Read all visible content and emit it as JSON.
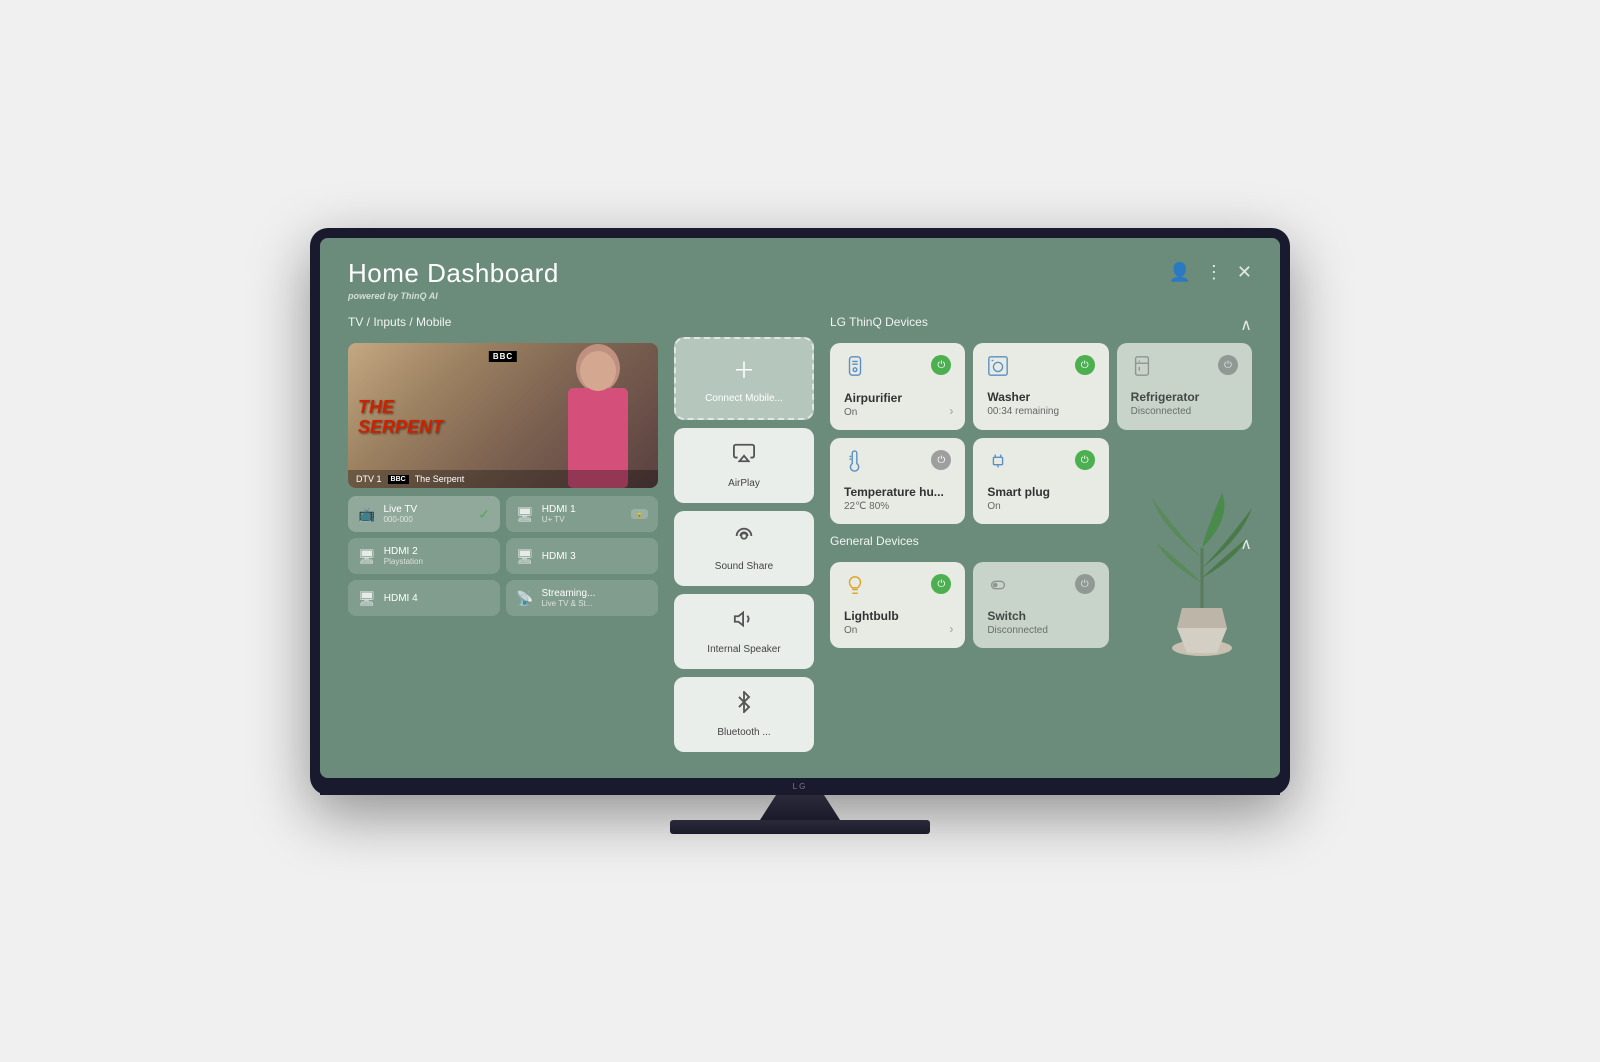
{
  "page": {
    "title": "Home Dashboard",
    "subtitle_pre": "powered by",
    "subtitle_brand": "ThinQ AI"
  },
  "header": {
    "user_icon": "👤",
    "menu_icon": "⋮",
    "close_icon": "✕"
  },
  "tv_section": {
    "label": "TV / Inputs / Mobile",
    "channel": "DTV 1",
    "channel_badge": "BBC",
    "show": "The Serpent",
    "show_line1": "THE",
    "show_line2": "SERPENT"
  },
  "inputs": [
    {
      "name": "Live TV",
      "sub": "000-000",
      "icon": "📺",
      "active": true
    },
    {
      "name": "HDMI 1",
      "sub": "U+ TV",
      "icon": "⬛",
      "active": false,
      "badge": "⬡"
    },
    {
      "name": "HDMI 2",
      "sub": "Playstation",
      "icon": "⬛",
      "active": false
    },
    {
      "name": "HDMI 3",
      "sub": "",
      "icon": "⬛",
      "active": false
    },
    {
      "name": "HDMI 4",
      "sub": "",
      "icon": "⬛",
      "active": false
    },
    {
      "name": "Streaming...",
      "sub": "Live TV & St...",
      "icon": "⬛",
      "active": false
    }
  ],
  "actions": [
    {
      "id": "connect",
      "label": "Connect Mobile...",
      "icon": "+",
      "type": "connect"
    },
    {
      "id": "airplay",
      "label": "AirPlay",
      "icon": "📡"
    },
    {
      "id": "soundshare",
      "label": "Sound Share",
      "icon": "🔊"
    },
    {
      "id": "speaker",
      "label": "Internal Speaker",
      "icon": "🔈"
    },
    {
      "id": "bluetooth",
      "label": "Bluetooth ...",
      "icon": "🎵"
    }
  ],
  "lg_thinq": {
    "section_label": "LG ThinQ Devices",
    "devices": [
      {
        "id": "airpurifier",
        "name": "Airpurifier",
        "status": "On",
        "icon": "💨",
        "power": "on",
        "has_arrow": true
      },
      {
        "id": "washer",
        "name": "Washer",
        "status": "00:34 remaining",
        "icon": "🫧",
        "power": "on",
        "has_arrow": false
      },
      {
        "id": "refrigerator",
        "name": "Refrigerator",
        "status": "Disconnected",
        "icon": "🧊",
        "power": "off",
        "has_arrow": false,
        "disconnected": true
      },
      {
        "id": "temp",
        "name": "Temperature hu...",
        "status": "22℃ 80%",
        "icon": "🌡️",
        "power": "off",
        "has_arrow": false
      },
      {
        "id": "smartplug",
        "name": "Smart plug",
        "status": "On",
        "icon": "🔌",
        "power": "on",
        "has_arrow": false
      }
    ]
  },
  "general_devices": {
    "section_label": "General Devices",
    "devices": [
      {
        "id": "lightbulb",
        "name": "Lightbulb",
        "status": "On",
        "icon": "💡",
        "power": "on",
        "has_arrow": true
      },
      {
        "id": "switch",
        "name": "Switch",
        "status": "Disconnected",
        "icon": "🔋",
        "power": "off",
        "has_arrow": false,
        "disconnected": true
      }
    ]
  },
  "colors": {
    "bg": "#6b8c7a",
    "card_bg": "rgba(245,245,240,0.9)",
    "power_on": "#4CAF50",
    "power_off": "#9e9e9e",
    "text_primary": "#333333",
    "text_secondary": "#666666"
  }
}
